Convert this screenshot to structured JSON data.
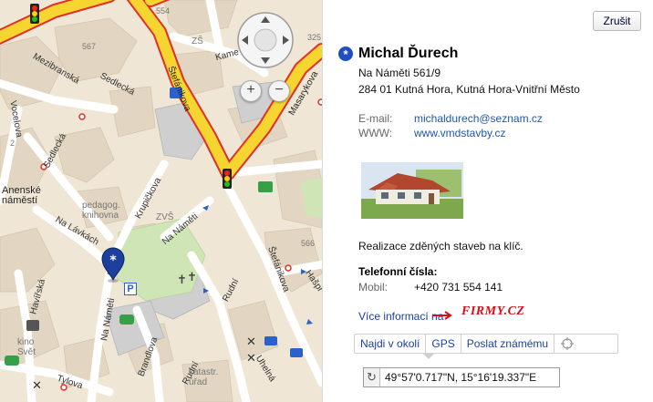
{
  "map": {
    "streets": [
      {
        "id": "mezibranska",
        "text": "Mezibranská"
      },
      {
        "id": "sedlecka1",
        "text": "Sedlecká"
      },
      {
        "id": "sedlecka2",
        "text": "Sedlecká"
      },
      {
        "id": "vocelova",
        "text": "Vocelova"
      },
      {
        "id": "stefanikova1",
        "text": "Štefánikova"
      },
      {
        "id": "stefanikova2",
        "text": "Štefánikova"
      },
      {
        "id": "masarykova",
        "text": "Masarykova"
      },
      {
        "id": "kamenna",
        "text": "Kame"
      },
      {
        "id": "kripickova",
        "text": "Krupičkova"
      },
      {
        "id": "na_lavkach",
        "text": "Na Lávkách"
      },
      {
        "id": "na_nameti1",
        "text": "Na Náměti"
      },
      {
        "id": "na_nameti2",
        "text": "Na Náměti"
      },
      {
        "id": "havirska",
        "text": "Havířská"
      },
      {
        "id": "rudni1",
        "text": "Rudní"
      },
      {
        "id": "rudni2",
        "text": "Rudní"
      },
      {
        "id": "brandlova",
        "text": "Brandlova"
      },
      {
        "id": "tylova",
        "text": "Tylova"
      },
      {
        "id": "haspr",
        "text": "Hašpr"
      },
      {
        "id": "uhelna",
        "text": "Uhelná"
      },
      {
        "id": "anenske",
        "text": "Anenské\nnáměstí"
      },
      {
        "id": "pedagog",
        "text": "pedagog.\nknihovna"
      },
      {
        "id": "kino",
        "text": "kino\nSvět"
      },
      {
        "id": "katastr",
        "text": "katastr.\núřad"
      },
      {
        "id": "zs",
        "text": "ZŠ"
      },
      {
        "id": "zvs",
        "text": "ZVŠ"
      }
    ],
    "house_numbers": [
      "554",
      "567",
      "566",
      "2",
      "561",
      "325"
    ],
    "parking_label": "P",
    "zoom_in": "+",
    "zoom_out": "−"
  },
  "panel": {
    "close_label": "Zrušit",
    "star_symbol": "*",
    "name": "Michal Ďurech",
    "address_line1": "Na Náměti 561/9",
    "address_line2": "284 01 Kutná Hora, Kutná Hora-Vnitřní Město",
    "email_label": "E-mail:",
    "email_value": "michaldurech@seznam.cz",
    "www_label": "WWW:",
    "www_value": "www.vmdstavby.cz",
    "description": "Realizace zděných staveb na klíč.",
    "phones_title": "Telefonní čísla:",
    "mobile_label": "Mobil:",
    "mobile_value": "+420 731 554 141",
    "more_info": "Více informací na",
    "firmy_logo": "FIRMY.CZ",
    "actions": [
      "Najdi v okolí",
      "GPS",
      "Poslat známému"
    ],
    "coord_button": "↻",
    "coordinates": "49°57'0.717\"N, 15°16'19.337\"E"
  },
  "colors": {
    "main_road": "#f7d530",
    "main_road_border": "#e0302a",
    "link": "#2255aa",
    "firmy_red": "#d3111b"
  }
}
